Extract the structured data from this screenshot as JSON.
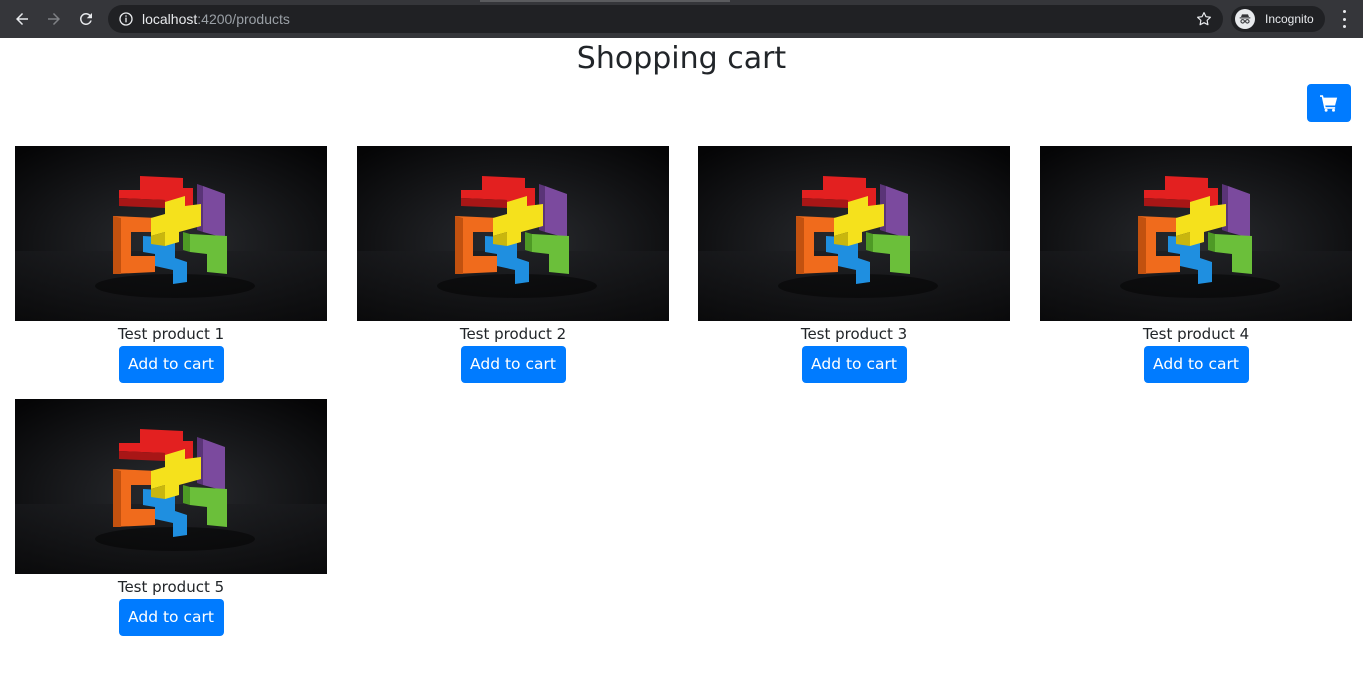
{
  "browser": {
    "url_host": "localhost",
    "url_path": ":4200/products",
    "profile_label": "Incognito"
  },
  "page": {
    "title": "Shopping cart"
  },
  "colors": {
    "primary": "#007bff",
    "text": "#212529",
    "chrome": "#35363a"
  },
  "products": [
    {
      "name": "Test product 1",
      "button_label": "Add to cart"
    },
    {
      "name": "Test product 2",
      "button_label": "Add to cart"
    },
    {
      "name": "Test product 3",
      "button_label": "Add to cart"
    },
    {
      "name": "Test product 4",
      "button_label": "Add to cart"
    },
    {
      "name": "Test product 5",
      "button_label": "Add to cart"
    }
  ],
  "icons": {
    "cart": "shopping-cart-icon",
    "back": "arrow-left-icon",
    "forward": "arrow-right-icon",
    "reload": "reload-icon",
    "info": "info-icon",
    "bookmark": "star-icon",
    "incognito": "incognito-icon",
    "menu": "kebab-menu-icon"
  }
}
